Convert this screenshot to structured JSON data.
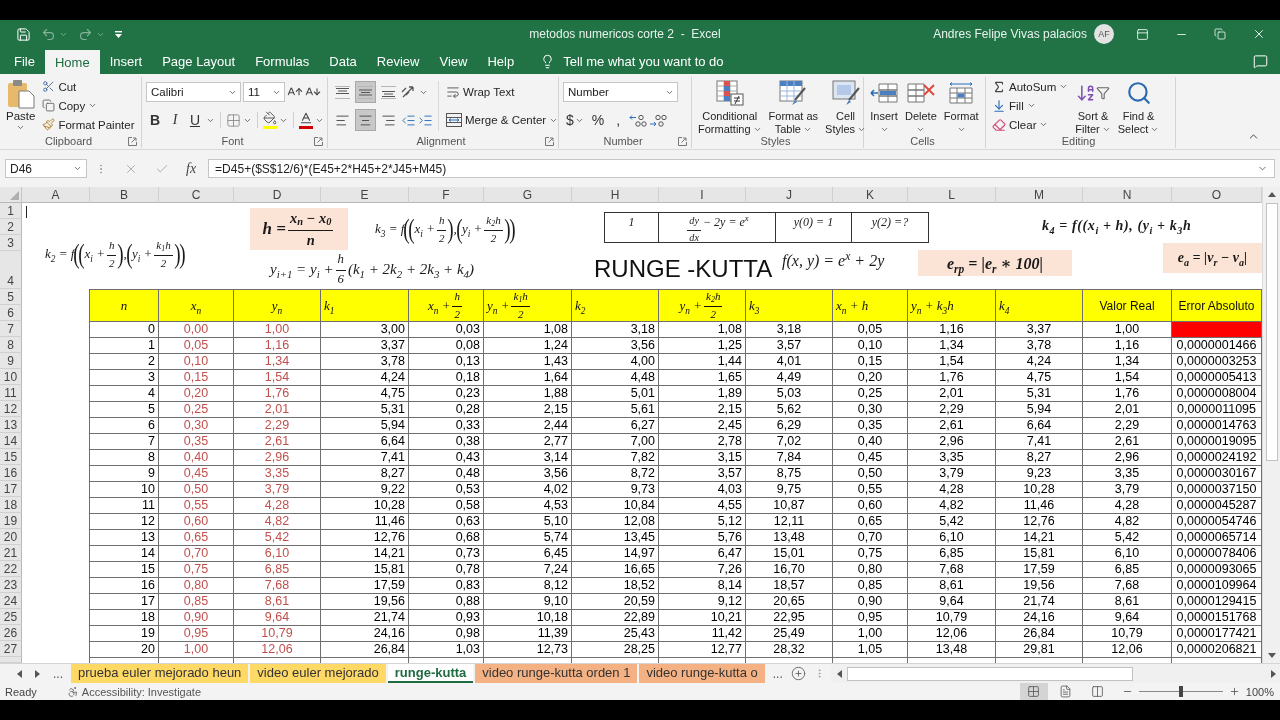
{
  "title_bar": {
    "quick_access": [
      {
        "kind": "save",
        "disabled": false
      },
      {
        "kind": "undo",
        "disabled": true
      },
      {
        "kind": "redo",
        "disabled": true
      },
      {
        "kind": "customize",
        "disabled": false
      }
    ],
    "title": "metodos numericos corte 2  -  Excel",
    "user": "Andres Felipe Vivas palacios",
    "avatar": "AF"
  },
  "menu_tabs": [
    {
      "label": "File",
      "selected": false
    },
    {
      "label": "Home",
      "selected": true
    },
    {
      "label": "Insert",
      "selected": false
    },
    {
      "label": "Page Layout",
      "selected": false
    },
    {
      "label": "Formulas",
      "selected": false
    },
    {
      "label": "Data",
      "selected": false
    },
    {
      "label": "Review",
      "selected": false
    },
    {
      "label": "View",
      "selected": false
    },
    {
      "label": "Help",
      "selected": false
    }
  ],
  "tell_me": "Tell me what you want to do",
  "ribbon": {
    "clipboard": {
      "paste": "Paste",
      "items": [
        {
          "kind": "cut",
          "label": "Cut"
        },
        {
          "kind": "copy",
          "label": "Copy"
        },
        {
          "kind": "painter",
          "label": "Format Painter"
        }
      ],
      "label": "Clipboard"
    },
    "font": {
      "name": "Calibri",
      "size": "11",
      "styles": [
        "B",
        "I",
        "U"
      ],
      "label": "Font"
    },
    "alignment": {
      "vertical": [
        {
          "kind": "top",
          "selected": false
        },
        {
          "kind": "middle",
          "selected": true
        },
        {
          "kind": "bottom",
          "selected": false
        }
      ],
      "horizontal": [
        {
          "kind": "left",
          "selected": false
        },
        {
          "kind": "center",
          "selected": true
        },
        {
          "kind": "right",
          "selected": false
        }
      ],
      "wrap": "Wrap Text",
      "merge": "Merge & Center",
      "label": "Alignment"
    },
    "number": {
      "format": "Number",
      "symbols": [
        "$",
        "%",
        ","
      ],
      "label": "Number"
    },
    "styles": {
      "buttons": [
        {
          "kind": "conditional",
          "lines": [
            "Conditional",
            "Formatting"
          ]
        },
        {
          "kind": "table",
          "lines": [
            "Format as",
            "Table"
          ]
        },
        {
          "kind": "cell_styles",
          "lines": [
            "Cell",
            "Styles"
          ]
        }
      ],
      "label": "Styles"
    },
    "cells": {
      "buttons": [
        {
          "kind": "insert",
          "label": "Insert"
        },
        {
          "kind": "delete",
          "label": "Delete"
        },
        {
          "kind": "format",
          "label": "Format"
        }
      ],
      "label": "Cells"
    },
    "editing": {
      "items": [
        {
          "kind": "autosum",
          "label": "AutoSum"
        },
        {
          "kind": "fill",
          "label": "Fill"
        },
        {
          "kind": "clear",
          "label": "Clear"
        }
      ],
      "buttons": [
        {
          "kind": "sort",
          "lines": [
            "Sort &",
            "Filter"
          ]
        },
        {
          "kind": "find",
          "lines": [
            "Find &",
            "Select"
          ]
        }
      ],
      "label": "Editing"
    }
  },
  "formula_bar": {
    "name_box": "D46",
    "function_label": "fx",
    "formula": "=D45+($S$12/6)*(E45+2*H45+2*J45+M45)"
  },
  "sheet": {
    "column_headers": [
      "A",
      "B",
      "C",
      "D",
      "E",
      "F",
      "G",
      "H",
      "I",
      "J",
      "K",
      "L",
      "M",
      "N",
      "O"
    ],
    "row_numbers": [
      "1",
      "2",
      "3",
      "4",
      "5",
      "6",
      "7",
      "8",
      "9",
      "10",
      "11",
      "12",
      "13",
      "14",
      "15",
      "16",
      "17",
      "18",
      "19",
      "20",
      "21",
      "22",
      "23",
      "24",
      "25",
      "26",
      "27"
    ],
    "equations": [
      {
        "kind": "boxed",
        "parts": [
          {
            "kind": "text",
            "s": "h = "
          },
          {
            "kind": "frac",
            "num": "x$_{n}$ − x$_{0}$",
            "den": "n"
          }
        ]
      },
      {
        "kind": "plain",
        "parts": [
          {
            "kind": "text",
            "s": "k$_{3}$ = f"
          },
          {
            "kind": "big",
            "s": "("
          },
          {
            "kind": "big",
            "s": "("
          },
          {
            "kind": "text",
            "s": "x$_{i}$ + "
          },
          {
            "kind": "frac",
            "num": "h",
            "den": "2"
          },
          {
            "kind": "big",
            "s": ")"
          },
          {
            "kind": "text",
            "s": ","
          },
          {
            "kind": "big",
            "s": "("
          },
          {
            "kind": "text",
            "s": "y$_{i}$ + "
          },
          {
            "kind": "frac",
            "num": "k$_{2}$h",
            "den": "2"
          },
          {
            "kind": "big",
            "s": ")"
          },
          {
            "kind": "big",
            "s": ")"
          }
        ]
      },
      {
        "kind": "bold",
        "parts": [
          {
            "kind": "text",
            "s": "k$_{4}$ = f((x$_{i}$ + h), (y$_{i}$ + k$_{3}$h"
          }
        ]
      },
      {
        "kind": "plain",
        "parts": [
          {
            "kind": "text",
            "s": "k$_{2}$ = f"
          },
          {
            "kind": "big",
            "s": "("
          },
          {
            "kind": "big",
            "s": "("
          },
          {
            "kind": "text",
            "s": "x$_{i}$ + "
          },
          {
            "kind": "frac",
            "num": "h",
            "den": "2"
          },
          {
            "kind": "big",
            "s": ")"
          },
          {
            "kind": "text",
            "s": ","
          },
          {
            "kind": "big",
            "s": "("
          },
          {
            "kind": "text",
            "s": "y$_{i}$ + "
          },
          {
            "kind": "frac",
            "num": "k$_{1}$h",
            "den": "2"
          },
          {
            "kind": "big",
            "s": ")"
          },
          {
            "kind": "big",
            "s": ")"
          }
        ]
      },
      {
        "kind": "plain",
        "parts": [
          {
            "kind": "text",
            "s": "y$_{i+1}$ = y$_{i}$ + "
          },
          {
            "kind": "frac",
            "num": "h",
            "den": "6"
          },
          {
            "kind": "text",
            "s": "(k$_{1}$ + 2k$_{2}$ + 2k$_{3}$ + k$_{4}$)"
          }
        ]
      },
      {
        "kind": "plain",
        "parts": [
          {
            "kind": "text",
            "s": "f(x, y) = e$^{x}$ + 2y"
          }
        ]
      },
      {
        "kind": "boxed",
        "parts": [
          {
            "kind": "text",
            "s": "e$_{rp}$ = |e$_{r}$ ∗ 100|"
          }
        ]
      },
      {
        "kind": "boxed",
        "parts": [
          {
            "kind": "text",
            "s": "e$_{a}$ = |v$_{r}$ − v$_{a}$|"
          }
        ]
      }
    ],
    "conditions": [
      {
        "parts": [
          {
            "kind": "text",
            "s": "1"
          }
        ]
      },
      {
        "parts": [
          {
            "kind": "frac",
            "num": "dy",
            "den": "dx"
          },
          {
            "kind": "text",
            "s": " − 2y = e$^{x}$"
          }
        ]
      },
      {
        "parts": [
          {
            "kind": "text",
            "s": "y(0) = 1"
          }
        ]
      },
      {
        "parts": [
          {
            "kind": "text",
            "s": "y(2) =?"
          }
        ]
      }
    ],
    "title": "RUNGE -KUTTA",
    "table": {
      "columns": [
        {
          "kind": "math",
          "parts": [
            {
              "kind": "text",
              "s": "n"
            }
          ]
        },
        {
          "kind": "math",
          "color": "#c0504d",
          "parts": [
            {
              "kind": "text",
              "s": "x$_{n}$"
            }
          ]
        },
        {
          "kind": "math",
          "color": "#c0504d",
          "parts": [
            {
              "kind": "text",
              "s": "y$_{n}$"
            }
          ]
        },
        {
          "kind": "math",
          "parts": [
            {
              "kind": "text",
              "s": "k$_{1}$"
            }
          ]
        },
        {
          "kind": "math",
          "parts": [
            {
              "kind": "text",
              "s": "x$_{n}$ + "
            },
            {
              "kind": "frac",
              "num": "h",
              "den": "2"
            }
          ]
        },
        {
          "kind": "math",
          "parts": [
            {
              "kind": "text",
              "s": "y$_{n}$ + "
            },
            {
              "kind": "frac",
              "num": "k$_{1}$h",
              "den": "2"
            }
          ]
        },
        {
          "kind": "math",
          "parts": [
            {
              "kind": "text",
              "s": "k$_{2}$"
            }
          ]
        },
        {
          "kind": "math",
          "parts": [
            {
              "kind": "text",
              "s": "y$_{n}$ + "
            },
            {
              "kind": "frac",
              "num": "k$_{2}$h",
              "den": "2"
            }
          ]
        },
        {
          "kind": "math",
          "parts": [
            {
              "kind": "text",
              "s": "k$_{3}$"
            }
          ]
        },
        {
          "kind": "math",
          "parts": [
            {
              "kind": "text",
              "s": "x$_{n}$ + h"
            }
          ]
        },
        {
          "kind": "math",
          "parts": [
            {
              "kind": "text",
              "s": "y$_{n}$ + k$_{3}$h"
            }
          ]
        },
        {
          "kind": "math",
          "parts": [
            {
              "kind": "text",
              "s": "k$_{4}$"
            }
          ]
        },
        {
          "kind": "label",
          "parts": [
            {
              "kind": "text",
              "s": "Valor Real"
            }
          ]
        },
        {
          "kind": "label",
          "parts": [
            {
              "kind": "text",
              "s": "Error Absoluto"
            }
          ]
        }
      ],
      "rows": [
        {
          "values": [
            "0",
            "0,00",
            "1,00",
            "3,00",
            "0,03",
            "1,08",
            "3,18",
            "1,08",
            "3,18",
            "0,05",
            "1,16",
            "3,37",
            "1,00"
          ],
          "flagged": true
        },
        {
          "values": [
            "1",
            "0,05",
            "1,16",
            "3,37",
            "0,08",
            "1,24",
            "3,56",
            "1,25",
            "3,57",
            "0,10",
            "1,34",
            "3,78",
            "1,16"
          ],
          "error": "0,0000001466",
          "flagged": false
        },
        {
          "values": [
            "2",
            "0,10",
            "1,34",
            "3,78",
            "0,13",
            "1,43",
            "4,00",
            "1,44",
            "4,01",
            "0,15",
            "1,54",
            "4,24",
            "1,34"
          ],
          "error": "0,0000003253",
          "flagged": false
        },
        {
          "values": [
            "3",
            "0,15",
            "1,54",
            "4,24",
            "0,18",
            "1,64",
            "4,48",
            "1,65",
            "4,49",
            "0,20",
            "1,76",
            "4,75",
            "1,54"
          ],
          "error": "0,0000005413",
          "flagged": false
        },
        {
          "values": [
            "4",
            "0,20",
            "1,76",
            "4,75",
            "0,23",
            "1,88",
            "5,01",
            "1,89",
            "5,03",
            "0,25",
            "2,01",
            "5,31",
            "1,76"
          ],
          "error": "0,0000008004",
          "flagged": false
        },
        {
          "values": [
            "5",
            "0,25",
            "2,01",
            "5,31",
            "0,28",
            "2,15",
            "5,61",
            "2,15",
            "5,62",
            "0,30",
            "2,29",
            "5,94",
            "2,01"
          ],
          "error": "0,0000011095",
          "flagged": false
        },
        {
          "values": [
            "6",
            "0,30",
            "2,29",
            "5,94",
            "0,33",
            "2,44",
            "6,27",
            "2,45",
            "6,29",
            "0,35",
            "2,61",
            "6,64",
            "2,29"
          ],
          "error": "0,0000014763",
          "flagged": false
        },
        {
          "values": [
            "7",
            "0,35",
            "2,61",
            "6,64",
            "0,38",
            "2,77",
            "7,00",
            "2,78",
            "7,02",
            "0,40",
            "2,96",
            "7,41",
            "2,61"
          ],
          "error": "0,0000019095",
          "flagged": false
        },
        {
          "values": [
            "8",
            "0,40",
            "2,96",
            "7,41",
            "0,43",
            "3,14",
            "7,82",
            "3,15",
            "7,84",
            "0,45",
            "3,35",
            "8,27",
            "2,96"
          ],
          "error": "0,0000024192",
          "flagged": false
        },
        {
          "values": [
            "9",
            "0,45",
            "3,35",
            "8,27",
            "0,48",
            "3,56",
            "8,72",
            "3,57",
            "8,75",
            "0,50",
            "3,79",
            "9,23",
            "3,35"
          ],
          "error": "0,0000030167",
          "flagged": false
        },
        {
          "values": [
            "10",
            "0,50",
            "3,79",
            "9,22",
            "0,53",
            "4,02",
            "9,73",
            "4,03",
            "9,75",
            "0,55",
            "4,28",
            "10,28",
            "3,79"
          ],
          "error": "0,0000037150",
          "flagged": false
        },
        {
          "values": [
            "11",
            "0,55",
            "4,28",
            "10,28",
            "0,58",
            "4,53",
            "10,84",
            "4,55",
            "10,87",
            "0,60",
            "4,82",
            "11,46",
            "4,28"
          ],
          "error": "0,0000045287",
          "flagged": false
        },
        {
          "values": [
            "12",
            "0,60",
            "4,82",
            "11,46",
            "0,63",
            "5,10",
            "12,08",
            "5,12",
            "12,11",
            "0,65",
            "5,42",
            "12,76",
            "4,82"
          ],
          "error": "0,0000054746",
          "flagged": false
        },
        {
          "values": [
            "13",
            "0,65",
            "5,42",
            "12,76",
            "0,68",
            "5,74",
            "13,45",
            "5,76",
            "13,48",
            "0,70",
            "6,10",
            "14,21",
            "5,42"
          ],
          "error": "0,0000065714",
          "flagged": false
        },
        {
          "values": [
            "14",
            "0,70",
            "6,10",
            "14,21",
            "0,73",
            "6,45",
            "14,97",
            "6,47",
            "15,01",
            "0,75",
            "6,85",
            "15,81",
            "6,10"
          ],
          "error": "0,0000078406",
          "flagged": false
        },
        {
          "values": [
            "15",
            "0,75",
            "6,85",
            "15,81",
            "0,78",
            "7,24",
            "16,65",
            "7,26",
            "16,70",
            "0,80",
            "7,68",
            "17,59",
            "6,85"
          ],
          "error": "0,0000093065",
          "flagged": false
        },
        {
          "values": [
            "16",
            "0,80",
            "7,68",
            "17,59",
            "0,83",
            "8,12",
            "18,52",
            "8,14",
            "18,57",
            "0,85",
            "8,61",
            "19,56",
            "7,68"
          ],
          "error": "0,0000109964",
          "flagged": false
        },
        {
          "values": [
            "17",
            "0,85",
            "8,61",
            "19,56",
            "0,88",
            "9,10",
            "20,59",
            "9,12",
            "20,65",
            "0,90",
            "9,64",
            "21,74",
            "8,61"
          ],
          "error": "0,0000129415",
          "flagged": false
        },
        {
          "values": [
            "18",
            "0,90",
            "9,64",
            "21,74",
            "0,93",
            "10,18",
            "22,89",
            "10,21",
            "22,95",
            "0,95",
            "10,79",
            "24,16",
            "9,64"
          ],
          "error": "0,0000151768",
          "flagged": false
        },
        {
          "values": [
            "19",
            "0,95",
            "10,79",
            "24,16",
            "0,98",
            "11,39",
            "25,43",
            "11,42",
            "25,49",
            "1,00",
            "12,06",
            "26,84",
            "10,79"
          ],
          "error": "0,0000177421",
          "flagged": false
        },
        {
          "values": [
            "20",
            "1,00",
            "12,06",
            "26,84",
            "1,03",
            "12,73",
            "28,25",
            "12,77",
            "28,32",
            "1,05",
            "13,48",
            "29,81",
            "12,06"
          ],
          "error": "0,0000206821",
          "flagged": false
        }
      ]
    }
  },
  "sheet_tabs": {
    "overflow_left": "...",
    "tabs": [
      {
        "label": "prueba euler mejorado heun",
        "color": "#ffd966",
        "selected": false
      },
      {
        "label": "video euler mejorado",
        "color": "#ffd966",
        "selected": false
      },
      {
        "label": "runge-kutta",
        "selected": true
      },
      {
        "label": "video runge-kutta orden 1",
        "color": "#f4b183",
        "selected": false
      },
      {
        "label": "video runge-kutta o",
        "color": "#f4b183",
        "selected": false
      }
    ],
    "overflow_right": "..."
  },
  "status_bar": {
    "status": "Ready",
    "accessibility": "Accessibility: Investigate",
    "views": [
      {
        "kind": "normal",
        "selected": true
      },
      {
        "kind": "page_layout",
        "selected": false
      },
      {
        "kind": "page_break",
        "selected": false
      }
    ],
    "zoom": {
      "level": 0.5,
      "reading": "100%"
    }
  }
}
